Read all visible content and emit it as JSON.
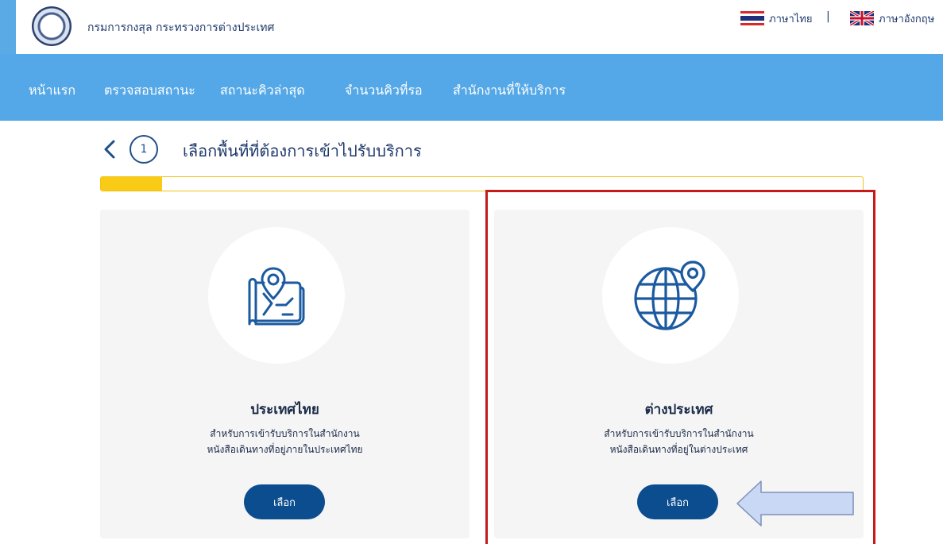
{
  "header": {
    "org_title": "กรมการกงสุล กระทรวงการต่างประเทศ",
    "languages": [
      {
        "label": "ภาษาไทย",
        "flag": "thai-flag-icon"
      },
      {
        "label": "ภาษาอังกฤษ",
        "flag": "uk-flag-icon"
      }
    ],
    "separator": "|"
  },
  "nav": {
    "items": [
      {
        "label": "หน้าแรก"
      },
      {
        "label": "ตรวจสอบสถานะ"
      },
      {
        "label": "สถานะคิวล่าสุด"
      },
      {
        "label": "จำนวนคิวที่รอ"
      },
      {
        "label": "สำนักงานที่ให้บริการ"
      }
    ]
  },
  "step": {
    "number": "1",
    "title": "เลือกพื้นที่ที่ต้องการเข้าไปรับบริการ",
    "progress_fraction": 0.08
  },
  "cards": [
    {
      "title": "ประเทศไทย",
      "desc_line1": "สำหรับการเข้ารับบริการในสำนักงาน",
      "desc_line2": "หนังสือเดินทางที่อยู่ภายในประเทศไทย",
      "button": "เลือก",
      "icon": "map-pin-icon"
    },
    {
      "title": "ต่างประเทศ",
      "desc_line1": "สำหรับการเข้ารับบริการในสำนักงาน",
      "desc_line2": "หนังสือเดินทางที่อยู่ในต่างประเทศ",
      "button": "เลือก",
      "icon": "globe-pin-icon"
    }
  ],
  "colors": {
    "nav_bg": "#55a8e7",
    "button_bg": "#0b4d8f",
    "progress_fill": "#f9cb16",
    "highlight": "#c41a1a"
  }
}
